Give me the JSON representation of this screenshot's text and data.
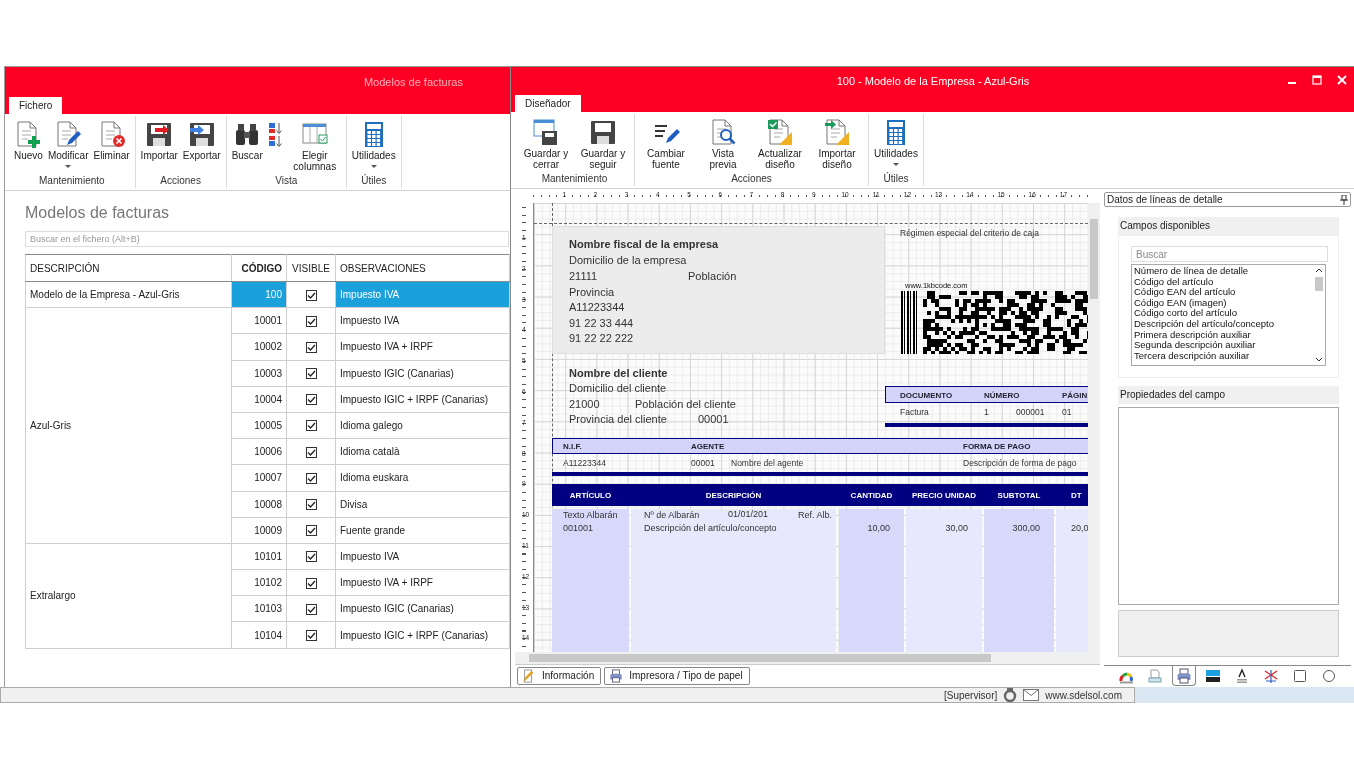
{
  "list_window": {
    "title": "Modelos de facturas",
    "tabs": [
      {
        "label": "Fichero",
        "selected": true
      }
    ],
    "ribbon": [
      {
        "label": "Mantenimiento",
        "buttons": [
          {
            "label": "Nuevo",
            "dropdown": false
          },
          {
            "label": "Modificar",
            "dropdown": true
          },
          {
            "label": "Eliminar",
            "dropdown": false
          }
        ]
      },
      {
        "label": "Acciones",
        "buttons": [
          {
            "label": "Importar",
            "dropdown": false
          },
          {
            "label": "Exportar",
            "dropdown": false
          }
        ]
      },
      {
        "label": "Vista",
        "buttons": [
          {
            "label": "Buscar",
            "dropdown": false
          },
          {
            "dropdown": false
          },
          {
            "label": "Elegir columnas",
            "dropdown": false
          }
        ]
      },
      {
        "label": "Útiles",
        "buttons": [
          {
            "label": "Utilidades",
            "dropdown": true
          }
        ]
      }
    ],
    "heading": "Modelos de facturas",
    "search": {
      "placeholder": "Buscar en el fichero (Alt+B)"
    },
    "table": {
      "columns": [
        {
          "label": "DESCRIPCIÓN",
          "sorted": false
        },
        {
          "label": "CÓDIGO",
          "sorted": true
        },
        {
          "label": "VISIBLE",
          "sorted": false
        },
        {
          "label": "OBSERVACIONES",
          "sorted": false
        }
      ],
      "groups": [
        {
          "description": "Modelo de la Empresa - Azul-Gris",
          "rows": [
            {
              "code": "100",
              "visible": true,
              "notes": "Impuesto IVA",
              "selected": true
            }
          ]
        },
        {
          "description": "Azul-Gris",
          "rows": [
            {
              "code": "10001",
              "visible": true,
              "notes": "Impuesto IVA",
              "selected": false
            },
            {
              "code": "10002",
              "visible": true,
              "notes": "Impuesto IVA + IRPF",
              "selected": false
            },
            {
              "code": "10003",
              "visible": true,
              "notes": "Impuesto IGIC (Canarias)",
              "selected": false
            },
            {
              "code": "10004",
              "visible": true,
              "notes": "Impuesto IGIC + IRPF (Canarias)",
              "selected": false
            },
            {
              "code": "10005",
              "visible": true,
              "notes": "Idioma galego",
              "selected": false
            },
            {
              "code": "10006",
              "visible": true,
              "notes": "Idioma català",
              "selected": false
            },
            {
              "code": "10007",
              "visible": true,
              "notes": "Idioma euskara",
              "selected": false
            },
            {
              "code": "10008",
              "visible": true,
              "notes": "Divisa",
              "selected": false
            },
            {
              "code": "10009",
              "visible": true,
              "notes": "Fuente grande",
              "selected": false
            }
          ]
        },
        {
          "description": "Extralargo",
          "rows": [
            {
              "code": "10101",
              "visible": true,
              "notes": "Impuesto IVA",
              "selected": false
            },
            {
              "code": "10102",
              "visible": true,
              "notes": "Impuesto IVA + IRPF",
              "selected": false
            },
            {
              "code": "10103",
              "visible": true,
              "notes": "Impuesto IGIC (Canarias)",
              "selected": false
            },
            {
              "code": "10104",
              "visible": true,
              "notes": "Impuesto IGIC + IRPF (Canarias)",
              "selected": false
            }
          ]
        }
      ]
    }
  },
  "designer_window": {
    "title": "100 - Modelo de la Empresa - Azul-Gris",
    "tabs": [
      {
        "label": "Diseñador",
        "selected": true
      }
    ],
    "ribbon": [
      {
        "label": "Mantenimiento",
        "buttons": [
          {
            "label": "Guardar y cerrar",
            "dropdown": false
          },
          {
            "label": "Guardar y seguir",
            "dropdown": false
          }
        ]
      },
      {
        "label": "Acciones",
        "buttons": [
          {
            "label": "Cambiar fuente",
            "dropdown": false
          },
          {
            "label": "Vista previa",
            "dropdown": false
          },
          {
            "label": "Actualizar diseño",
            "dropdown": false
          },
          {
            "label": "Importar diseño",
            "dropdown": false
          }
        ]
      },
      {
        "label": "Útiles",
        "buttons": [
          {
            "label": "Utilidades",
            "dropdown": true
          }
        ]
      }
    ],
    "ruler": {
      "horizontal": [
        "1",
        "2",
        "3",
        "4",
        "5",
        "6",
        "7",
        "8",
        "9",
        "10",
        "11",
        "12",
        "13",
        "14",
        "15",
        "16",
        "17"
      ],
      "vertical": [
        "1",
        "2",
        "3",
        "4",
        "5",
        "6",
        "7",
        "8",
        "9",
        "10",
        "11",
        "12",
        "13",
        "14"
      ]
    },
    "invoice": {
      "company": [
        "Nombre fiscal de la empresa",
        "Domicilio de la empresa",
        "21111",
        "Población",
        "Provincia",
        "A11223344",
        "91 22 33 444",
        "91 22 22 222"
      ],
      "regime_note": "Régimen especial del criterio de caja",
      "barcode_caption": "www.1kbcode.com",
      "client": [
        "Nombre del cliente",
        "Domicilio del cliente",
        "21000",
        "Población del cliente",
        "Provincia del cliente",
        "00001"
      ],
      "document_table": {
        "columns": [
          "DOCUMENTO",
          "NÚMERO",
          "PÁGIN"
        ],
        "values": [
          "Factura",
          "1",
          "000001",
          "01"
        ]
      },
      "agent_table": {
        "columns": [
          "N.I.F.",
          "AGENTE",
          "FORMA DE PAGO"
        ],
        "values": [
          "A11223344",
          "00001",
          "Nombre del agente",
          "Descripción de forma de pago"
        ]
      },
      "lines_table": {
        "columns": [
          "ARTÍCULO",
          "DESCRIPCIÓN",
          "CANTIDAD",
          "PRECIO UNIDAD",
          "SUBTOTAL",
          "DT"
        ],
        "cells": [
          [
            "Texto Albarán",
            "001001"
          ],
          [
            "Nº de Albarán",
            "01/01/201",
            "Ref. Alb.",
            "Descripción del artículo/concepto"
          ],
          [
            "10,00"
          ],
          [
            "30,00"
          ],
          [
            "300,00"
          ],
          [
            "20,0"
          ]
        ]
      }
    },
    "bottom_tabs": [
      {
        "label": "Información"
      },
      {
        "label": "Impresora / Tipo de papel"
      }
    ],
    "side_panel": {
      "title": "Datos de líneas de detalle",
      "fields_group": {
        "title": "Campos disponibles",
        "search": {
          "placeholder": "Buscar"
        },
        "items": [
          {
            "label": "Número de línea de detalle",
            "selected": false
          },
          {
            "label": "Código del artículo",
            "selected": false
          },
          {
            "label": "Código EAN del artículo",
            "selected": false
          },
          {
            "label": "Código EAN (imagen)",
            "selected": false
          },
          {
            "label": "Código corto del artículo",
            "selected": false
          },
          {
            "label": "Descripción del artículo/concepto",
            "selected": false
          },
          {
            "label": "Primera descripción auxiliar",
            "selected": false
          },
          {
            "label": "Segunda descripción auxiliar",
            "selected": false
          },
          {
            "label": "Tercera descripción auxiliar",
            "selected": false
          }
        ]
      },
      "properties_group": {
        "title": "Propiedades del campo"
      },
      "toolbox": [
        {
          "selected": false
        },
        {
          "selected": false
        },
        {
          "selected": true
        },
        {
          "selected": false
        },
        {
          "selected": false
        },
        {
          "selected": false
        },
        {
          "selected": false
        },
        {
          "selected": false
        }
      ]
    }
  },
  "status_bar": {
    "user": "[Supervisor]",
    "website": "www.sdelsol.com"
  }
}
